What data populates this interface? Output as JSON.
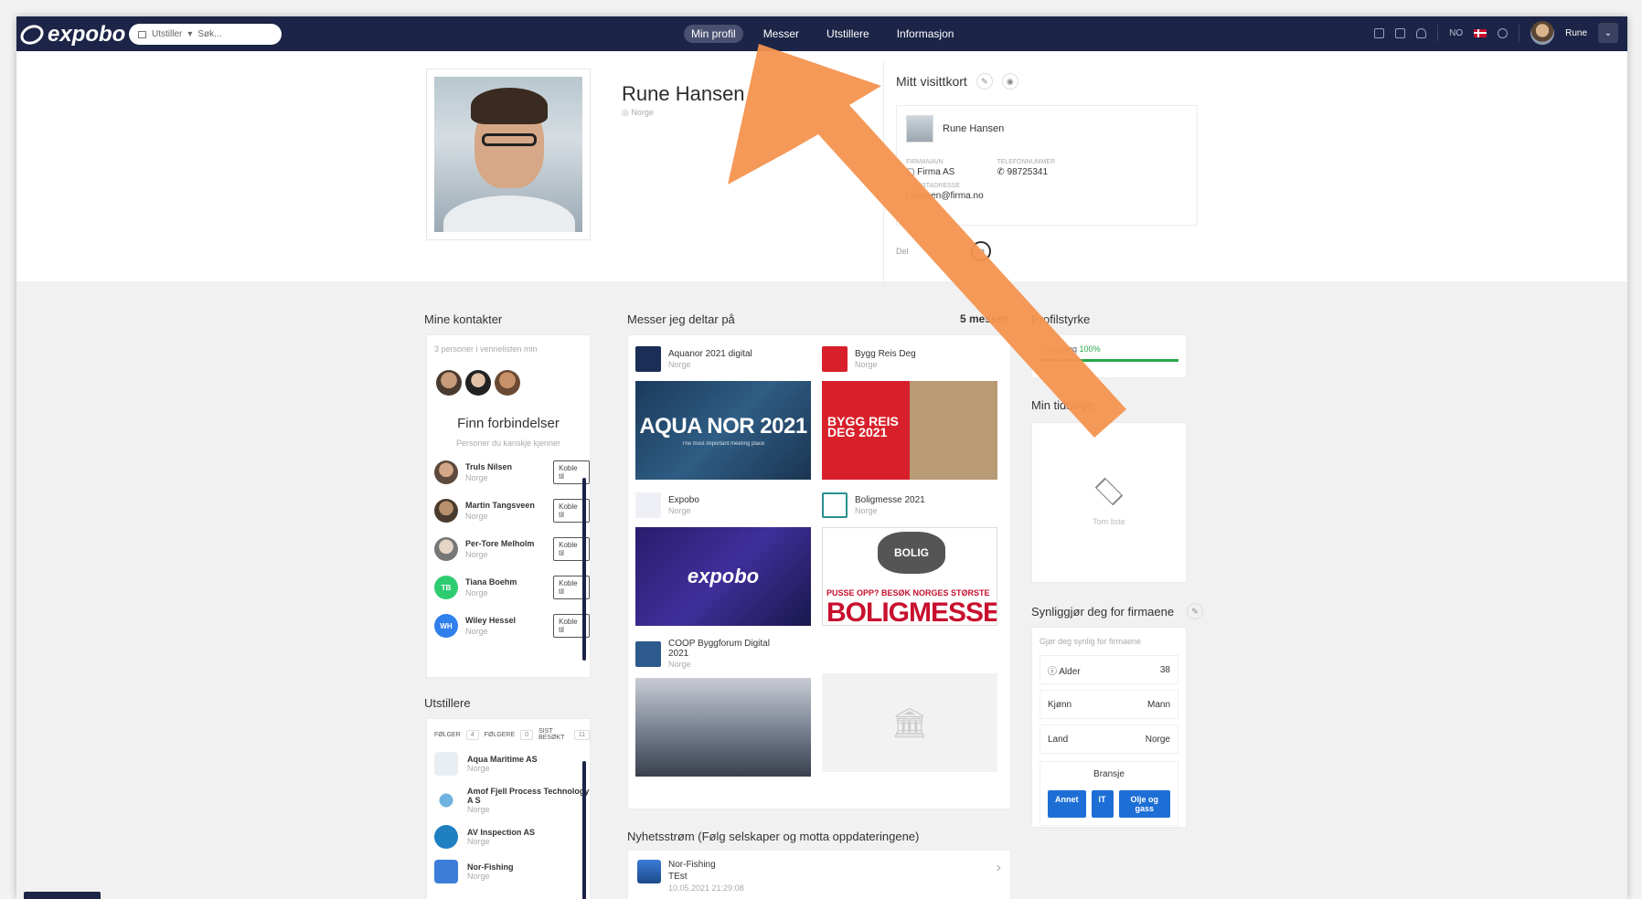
{
  "nav": {
    "logo_text": "expobo",
    "search_filter_label": "Utstiller",
    "search_placeholder": "Søk...",
    "links": [
      "Min profil",
      "Messer",
      "Utstillere",
      "Informasjon"
    ],
    "lang": "NO",
    "user_name": "Rune"
  },
  "profile": {
    "name": "Rune Hansen",
    "location": "Norge"
  },
  "business_card": {
    "title": "Mitt visittkort",
    "name": "Rune Hansen",
    "company_label": "FIRMANAVN",
    "company": "Firma AS",
    "phone_label": "TELEFONNUMMER",
    "phone": "98725341",
    "email_label": "E-POSTADRESSE",
    "email": "r.hansen@firma.no",
    "share_label": "Del"
  },
  "contacts": {
    "title": "Mine kontakter",
    "count_text": "3 personer i vennelisten min",
    "find_title": "Finn forbindelser",
    "find_sub": "Personer du kanskje kjenner",
    "connect_label": "Koble til",
    "people": [
      {
        "name": "Truls Nilsen",
        "loc": "Norge",
        "initials": ""
      },
      {
        "name": "Martin Tangsveen",
        "loc": "Norge",
        "initials": ""
      },
      {
        "name": "Per-Tore Melholm",
        "loc": "Norge",
        "initials": ""
      },
      {
        "name": "Tiana Boehm",
        "loc": "Norge",
        "initials": "TB"
      },
      {
        "name": "Wiley Hessel",
        "loc": "Norge",
        "initials": "WH"
      }
    ]
  },
  "exhibitors": {
    "title": "Utstillere",
    "tabs": [
      {
        "label": "FØLGER",
        "count": "4"
      },
      {
        "label": "FØLGERE",
        "count": "0"
      },
      {
        "label": "SIST BESØKT",
        "count": "11"
      }
    ],
    "items": [
      {
        "name": "Aqua Maritime AS",
        "loc": "Norge"
      },
      {
        "name": "Amof Fjell Process Technology A S",
        "loc": "Norge"
      },
      {
        "name": "AV Inspection AS",
        "loc": "Norge"
      },
      {
        "name": "Nor-Fishing",
        "loc": "Norge"
      }
    ]
  },
  "fairs": {
    "title": "Messer jeg deltar på",
    "count_text": "5 messer",
    "items": [
      {
        "name": "Aquanor 2021 digital",
        "loc": "Norge",
        "banner_title": "AQUA NOR 2021",
        "banner_sub": "The most important meeting place"
      },
      {
        "name": "Bygg Reis Deg",
        "loc": "Norge",
        "banner_title": "BYGG REIS DEG 2021"
      },
      {
        "name": "Expobo",
        "loc": "Norge",
        "banner_title": "expobo"
      },
      {
        "name": "Boligmesse 2021",
        "loc": "Norge",
        "banner_seal": "BOLIG",
        "banner_line1": "PUSSE OPP? BESØK NORGES STØRSTE",
        "banner_line2": "BOLIGMESSE"
      },
      {
        "name": "COOP Byggforum Digital 2021",
        "loc": "Norge"
      }
    ]
  },
  "news": {
    "title": "Nyhetsstrøm (Følg selskaper og motta oppdateringene)",
    "item_company": "Nor-Fishing",
    "item_text": "TEst",
    "item_time": "10.05.2021 21:29:08"
  },
  "strength": {
    "title": "Profilstyrke",
    "label": "Fremgang",
    "value_text": "100%",
    "value": 1.0
  },
  "my_list": {
    "title": "Min tidslinje",
    "empty_text": "Tom liste"
  },
  "visibility": {
    "title": "Synliggjør deg for firmaene",
    "sub": "Gjør deg synlig for firmaene",
    "rows": [
      {
        "label": "Alder",
        "value": "38"
      },
      {
        "label": "Kjønn",
        "value": "Mann"
      },
      {
        "label": "Land",
        "value": "Norge"
      }
    ],
    "branche_label": "Bransje",
    "tags": [
      "Annet",
      "IT",
      "Olje og gass"
    ]
  },
  "colors": {
    "nav_bg": "#1c2447",
    "accent_blue": "#1d6fd6",
    "progress_green": "#27a84a",
    "arrow_orange": "#f4944f"
  }
}
